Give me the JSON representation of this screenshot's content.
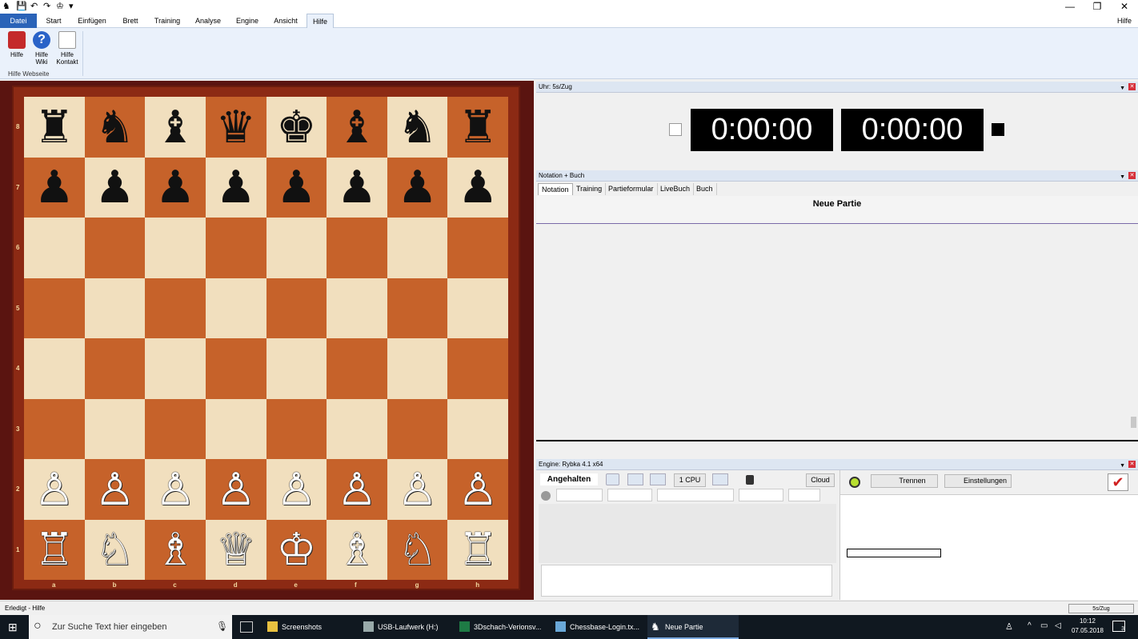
{
  "quick_access": [
    "♞",
    "💾",
    "↶",
    "↷",
    "♔",
    "▾"
  ],
  "app_help_label": "Hilfe",
  "window_controls": {
    "minimize": "—",
    "restore": "❐",
    "close": "✕"
  },
  "menu_tabs": [
    "Datei",
    "Start",
    "Einfügen",
    "Brett",
    "Training",
    "Analyse",
    "Engine",
    "Ansicht",
    "Hilfe"
  ],
  "ribbon": {
    "buttons": [
      {
        "label": "Hilfe",
        "icon": "help-book-icon"
      },
      {
        "label": "Hilfe\nWiki",
        "icon": "question-icon"
      },
      {
        "label": "Hilfe\nKontakt",
        "icon": "mail-icon"
      }
    ],
    "group_label": "Hilfe Webseite"
  },
  "board": {
    "ranks": [
      "8",
      "7",
      "6",
      "5",
      "4",
      "3",
      "2",
      "1"
    ],
    "files": [
      "a",
      "b",
      "c",
      "d",
      "e",
      "f",
      "g",
      "h"
    ],
    "position": [
      [
        "♜",
        "♞",
        "♝",
        "♛",
        "♚",
        "♝",
        "♞",
        "♜"
      ],
      [
        "♟",
        "♟",
        "♟",
        "♟",
        "♟",
        "♟",
        "♟",
        "♟"
      ],
      [
        "",
        "",
        "",
        "",
        "",
        "",
        "",
        ""
      ],
      [
        "",
        "",
        "",
        "",
        "",
        "",
        "",
        ""
      ],
      [
        "",
        "",
        "",
        "",
        "",
        "",
        "",
        ""
      ],
      [
        "",
        "",
        "",
        "",
        "",
        "",
        "",
        ""
      ],
      [
        "♙",
        "♙",
        "♙",
        "♙",
        "♙",
        "♙",
        "♙",
        "♙"
      ],
      [
        "♖",
        "♘",
        "♗",
        "♕",
        "♔",
        "♗",
        "♘",
        "♖"
      ]
    ]
  },
  "clock_panel": {
    "title": "Uhr: 5s/Zug",
    "white_time": "0:00:00",
    "black_time": "0:00:00"
  },
  "notation_panel": {
    "title": "Notation + Buch",
    "tabs": [
      "Notation",
      "Training",
      "Partieformular",
      "LiveBuch",
      "Buch"
    ],
    "game_title": "Neue Partie"
  },
  "engine_panel": {
    "title": "Engine: Rybka 4.1 x64",
    "status": "Angehalten",
    "cpu": "1 CPU",
    "cloud": "Cloud",
    "disconnect": "Trennen",
    "settings": "Einstellungen"
  },
  "status": {
    "left": "Erledigt - Hilfe",
    "right": "5s/Zug"
  },
  "taskbar": {
    "search_placeholder": "Zur Suche Text hier eingeben",
    "apps": [
      "Screenshots",
      "USB-Laufwerk (H:)",
      "3Dschach-Verionsv...",
      "Chessbase-Login.tx...",
      "Neue Partie"
    ],
    "time": "10:12",
    "date": "07.05.2018",
    "notifications": "3"
  },
  "colors": {
    "accent": "#2a63b8",
    "board_light": "#f1dfbe",
    "board_dark": "#c6622a",
    "frame": "#8c2a14"
  }
}
